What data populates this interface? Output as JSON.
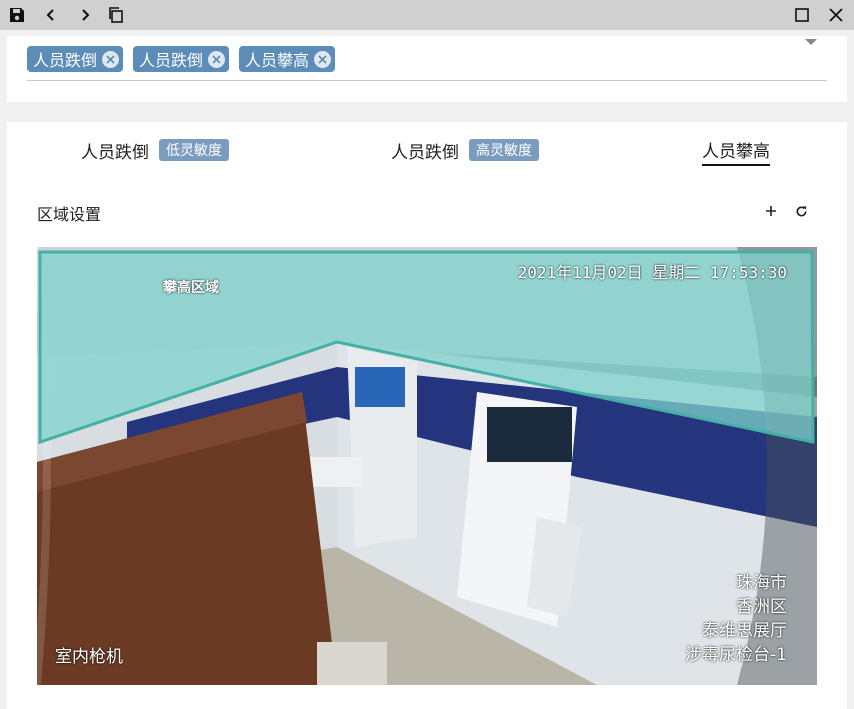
{
  "tags": [
    {
      "label": "人员跌倒"
    },
    {
      "label": "人员跌倒"
    },
    {
      "label": "人员攀高"
    }
  ],
  "tabs": [
    {
      "label": "人员跌倒",
      "badge": "低灵敏度"
    },
    {
      "label": "人员跌倒",
      "badge": "高灵敏度"
    },
    {
      "label": "人员攀高"
    }
  ],
  "section": {
    "title": "区域设置"
  },
  "camera": {
    "timestamp": "2021年11月02日 星期二 17:53:30",
    "region_label": "攀高区域",
    "location": {
      "line1": "珠海市",
      "line2": "香洲区",
      "line3": "泰维思展厅",
      "line4": "涉毒尿检台-1"
    },
    "camera_name": "室内枪机"
  },
  "icons": {
    "save": "save-icon",
    "back": "chevron-left-icon",
    "forward": "chevron-right-icon",
    "copy": "copy-icon",
    "maximize": "maximize-icon",
    "close": "close-icon",
    "add": "plus-icon",
    "refresh": "refresh-icon"
  },
  "colors": {
    "tag_bg": "#5b8db8",
    "badge_bg": "#7a9cbf",
    "region_fill": "#7fd3cc"
  }
}
